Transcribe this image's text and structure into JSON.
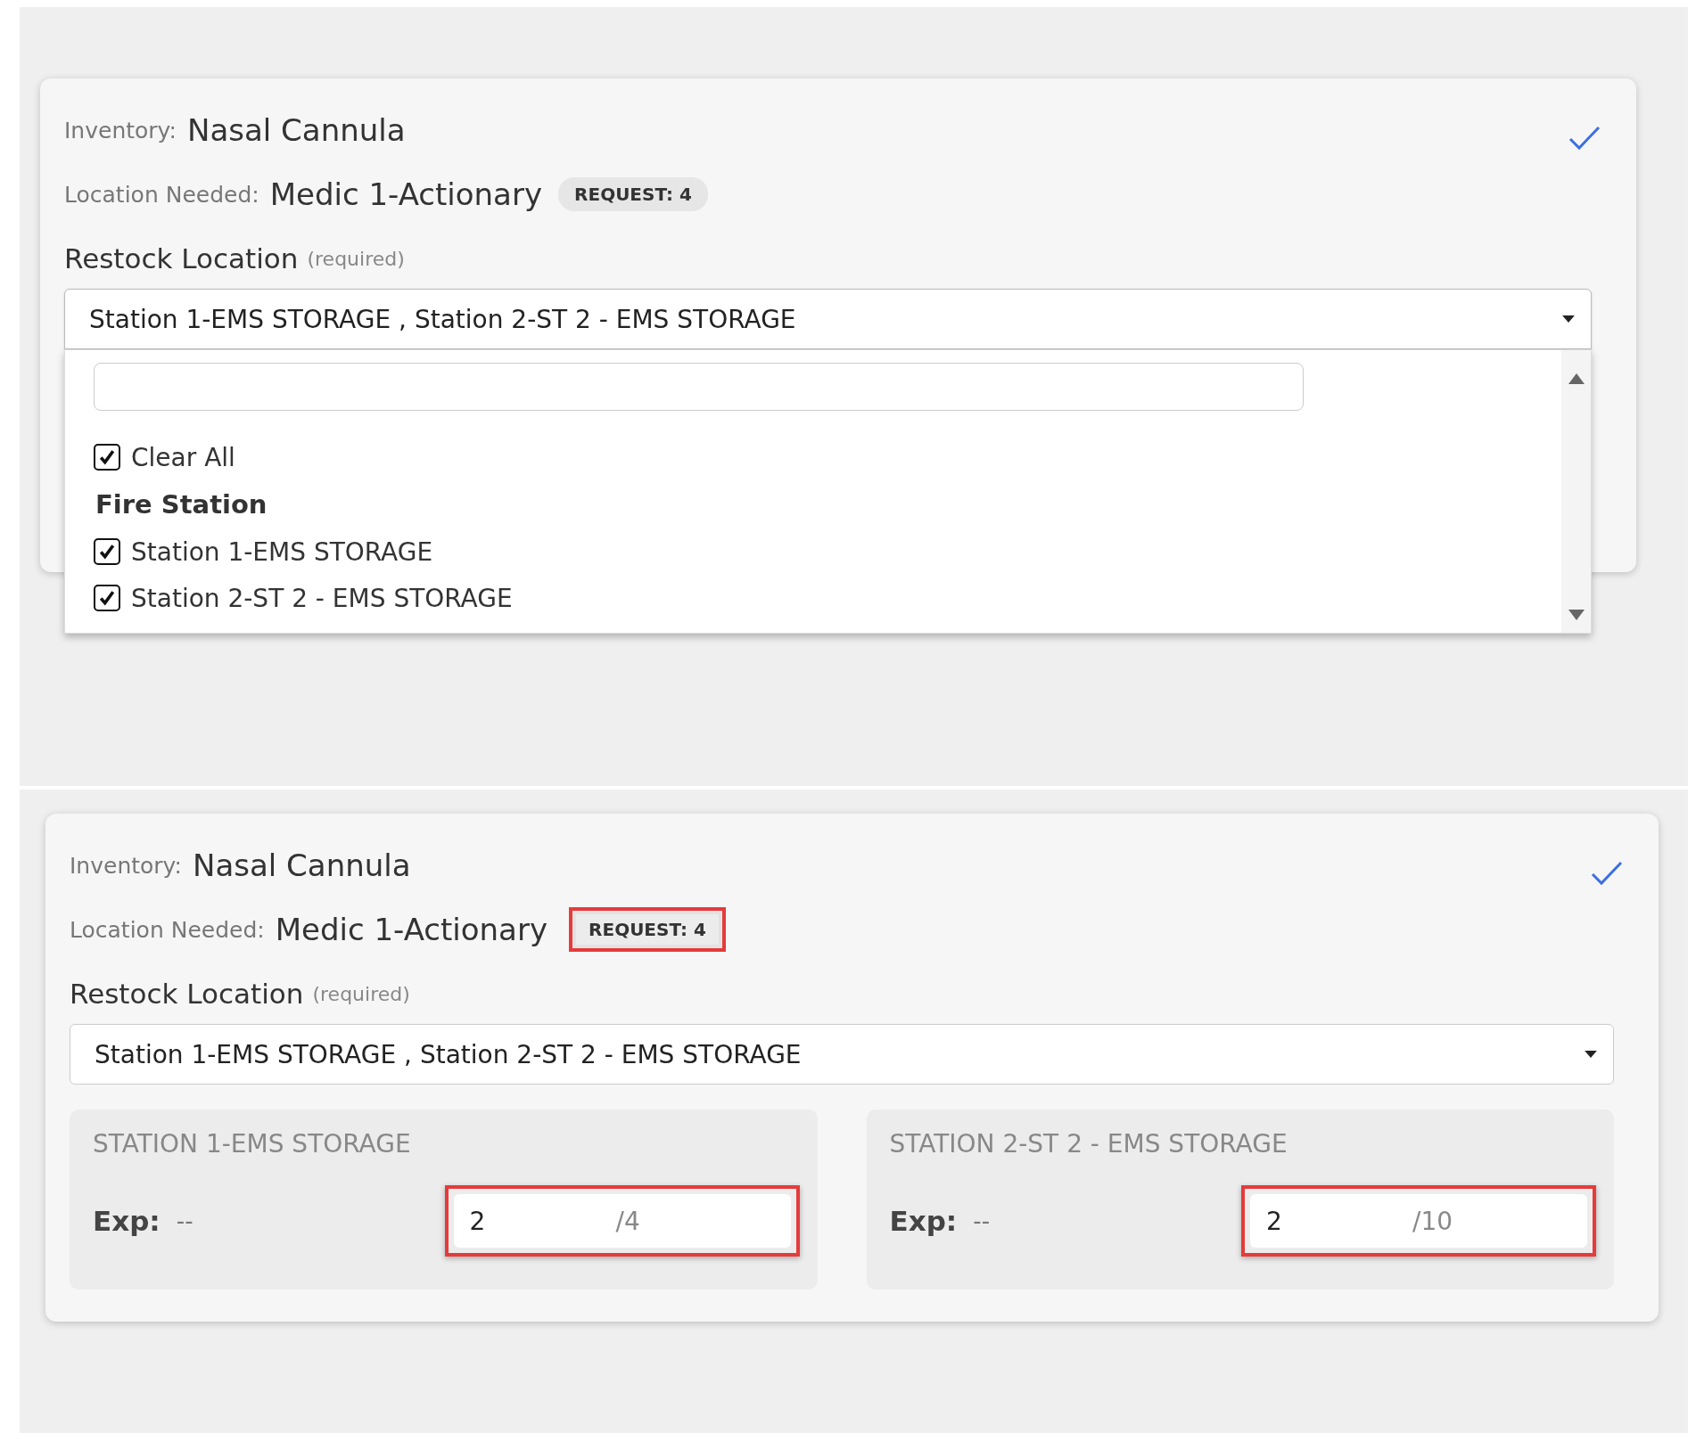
{
  "panels": [
    {
      "inventory_label": "Inventory:",
      "inventory": "Nasal Cannula",
      "location_label": "Location Needed:",
      "location": "Medic 1-Actionary",
      "request": {
        "text": "REQUEST: 4",
        "highlighted": false
      },
      "done": true,
      "restock_label": "Restock Location",
      "required": "(required)",
      "select": {
        "value": "Station 1-EMS STORAGE , Station 2-ST 2 - EMS STORAGE",
        "expanded": true
      },
      "dropdown": {
        "clear_all": {
          "label": "Clear All",
          "checked": true
        },
        "groups": [
          {
            "label": "Fire Station",
            "options": [
              {
                "label": "Station 1-EMS STORAGE",
                "checked": true
              },
              {
                "label": "Station 2-ST 2 - EMS STORAGE",
                "checked": true
              }
            ]
          }
        ]
      }
    },
    {
      "inventory_label": "Inventory:",
      "inventory": "Nasal Cannula",
      "location_label": "Location Needed:",
      "location": "Medic 1-Actionary",
      "request": {
        "text": "REQUEST: 4",
        "highlighted": true
      },
      "done": true,
      "restock_label": "Restock Location",
      "required": "(required)",
      "select": {
        "value": "Station 1-EMS STORAGE , Station 2-ST 2 - EMS STORAGE",
        "expanded": false
      },
      "stores": [
        {
          "title": "STATION 1-EMS STORAGE",
          "exp_label": "Exp:",
          "exp": "--",
          "value": "2",
          "max": "/4",
          "highlighted": true
        },
        {
          "title": "STATION 2-ST 2 - EMS STORAGE",
          "exp_label": "Exp:",
          "exp": "--",
          "value": "2",
          "max": "/10",
          "highlighted": true
        }
      ]
    }
  ]
}
